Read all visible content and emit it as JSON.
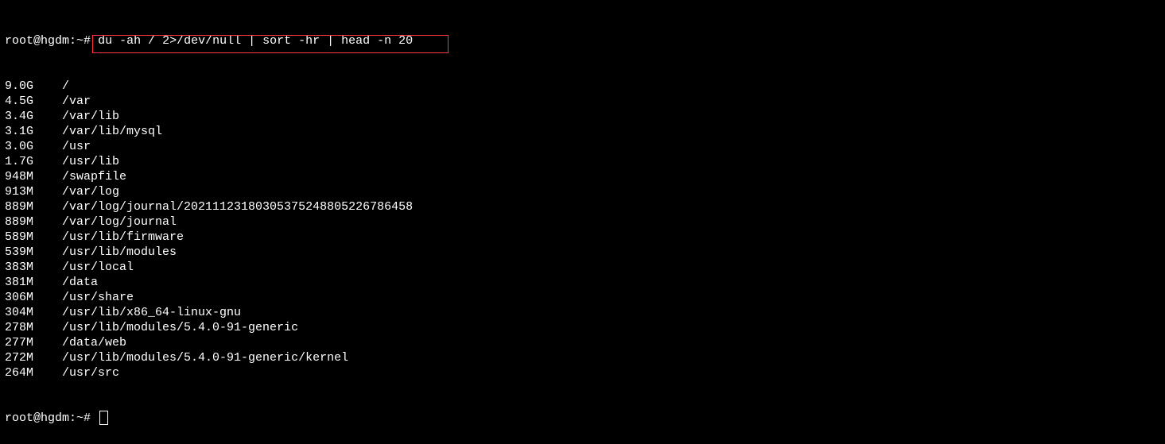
{
  "prompt1": {
    "user_host": "root@hgdm",
    "separator": ":",
    "cwd": "~",
    "symbol": "#",
    "command": "du -ah / 2>/dev/null | sort -hr | head -n 20"
  },
  "output": [
    {
      "size": "9.0G",
      "path": "/"
    },
    {
      "size": "4.5G",
      "path": "/var"
    },
    {
      "size": "3.4G",
      "path": "/var/lib"
    },
    {
      "size": "3.1G",
      "path": "/var/lib/mysql"
    },
    {
      "size": "3.0G",
      "path": "/usr"
    },
    {
      "size": "1.7G",
      "path": "/usr/lib"
    },
    {
      "size": "948M",
      "path": "/swapfile"
    },
    {
      "size": "913M",
      "path": "/var/log"
    },
    {
      "size": "889M",
      "path": "/var/log/journal/20211123180305375248805226786458"
    },
    {
      "size": "889M",
      "path": "/var/log/journal"
    },
    {
      "size": "589M",
      "path": "/usr/lib/firmware"
    },
    {
      "size": "539M",
      "path": "/usr/lib/modules"
    },
    {
      "size": "383M",
      "path": "/usr/local"
    },
    {
      "size": "381M",
      "path": "/data"
    },
    {
      "size": "306M",
      "path": "/usr/share"
    },
    {
      "size": "304M",
      "path": "/usr/lib/x86_64-linux-gnu"
    },
    {
      "size": "278M",
      "path": "/usr/lib/modules/5.4.0-91-generic"
    },
    {
      "size": "277M",
      "path": "/data/web"
    },
    {
      "size": "272M",
      "path": "/usr/lib/modules/5.4.0-91-generic/kernel"
    },
    {
      "size": "264M",
      "path": "/usr/src"
    }
  ],
  "prompt2": {
    "user_host": "root@hgdm",
    "separator": ":",
    "cwd": "~",
    "symbol": "#"
  }
}
